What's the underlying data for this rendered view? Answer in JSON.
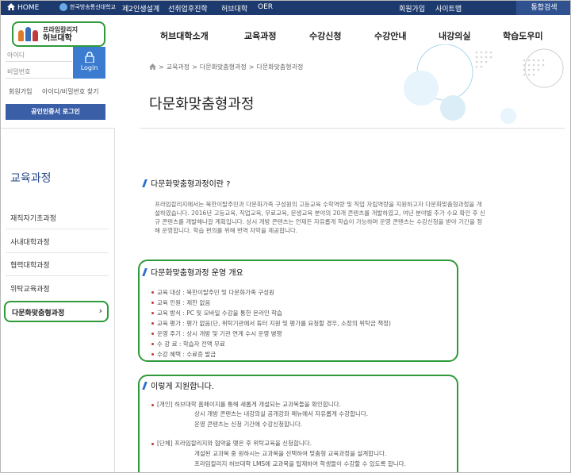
{
  "topbar": {
    "home": "HOME",
    "univ_mini": "한국방송통신대학교",
    "links": [
      "제2인생설계",
      "선취업후진학",
      "허브대학",
      "OER"
    ],
    "right_links": [
      "회원가입",
      "사이트맵"
    ],
    "search": "통합검색"
  },
  "logo": {
    "small": "프라임칼리지",
    "big": "허브대학"
  },
  "mainnav": [
    "허브대학소개",
    "교육과정",
    "수강신청",
    "수강안내",
    "내강의실",
    "학습도우미"
  ],
  "login": {
    "id_placeholder": "아이디",
    "pw_placeholder": "비밀번호",
    "button": "Login",
    "join": "회원가입",
    "find": "아이디/비밀번호 찾기",
    "cert": "공인인증서 로그인"
  },
  "sidebar": {
    "title": "교육과정",
    "items": [
      "재직자기초과정",
      "사내대학과정",
      "협력대학과정",
      "위탁교육과정"
    ],
    "active": "다문화맞춤형과정"
  },
  "breadcrumb": [
    "교육과정",
    "다문화맞춤형과정",
    "다문화맞춤형과정"
  ],
  "page_title": "다문화맞춤형과정",
  "section1": {
    "heading": "다문화맞춤형과정이란 ?",
    "lines": [
      "프라임칼리지에서는 북한이탈주민과 다문화가족 구성원의 고등교육 수학역량 및 직업 자립역량을 지원하고자 다문화맞춤형과정을 개",
      "설하였습니다. 2016년 고등교육, 직업교육, 무료교육, 문생교육 분야의 20개 콘텐츠를 개발하였고, 여년 분야별 추가 수요 확인 후 신",
      "규 콘텐츠를 개발해나갈 계획입니다. 상시 개방 콘텐츠는 언제든 자유롭게 학습이 가능하며 운영 콘텐츠는 수강신청을 받아 기간을 정",
      "해 운영합니다. 학습 편의를 위해 번역 자막을 제공합니다."
    ]
  },
  "section2": {
    "heading": "다문화맞춤형과정 운영 개요",
    "items": [
      "교육 대상 : 북한이탈주민 및 다문화가족 구성원",
      "교육 인원 : 제한 없음",
      "교육 방식 : PC 및 모바일 수강을 통한 온라인 학습",
      "교육 평가 : 평가 없음(단, 위탁기관에서 튜터 지원 및 평가를 요청할 경우, 소정의 위탁금 책정)",
      "운영 주기 : 상시 개방 및 기관 연계 수시 운영 병행",
      "수 강 료 : 학습자 전액 무료",
      "수강 혜택 : 수료증 발급"
    ]
  },
  "section3": {
    "heading": "이렇게 지원합니다.",
    "personal": [
      "[개인] 허브대학 홈페이지를 통해 새롭게 개설되는 교과목들을 확인합니다.",
      "상시 개방 콘텐츠는 내강의실 공개강좌 메뉴에서 자유롭게 수강합니다.",
      "운영 콘텐츠는 신청 기간에 수강신청합니다."
    ],
    "group": [
      "[단체] 프라임칼리지와 협약을 맺은 후 위탁교육을 신청합니다.",
      "개설된 교과목 중 원하시는 교과목을 선택하여 맞춤형 교육과정을 설계합니다.",
      "프라임칼리지 허브대학 LMS에 교과목을 탑재하여 학생들이 수강할 수 있도록 합니다."
    ]
  }
}
